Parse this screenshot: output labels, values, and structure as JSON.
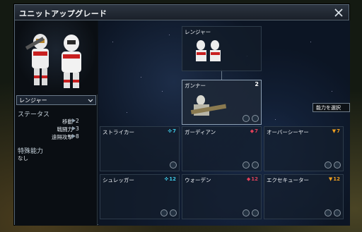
{
  "window": {
    "title": "ユニットアップグレード"
  },
  "left": {
    "selected_unit": "レンジャー",
    "status_heading": "ステータス",
    "stats": [
      {
        "label": "移動",
        "value": "2"
      },
      {
        "label": "戦闘力",
        "value": "3"
      },
      {
        "label": "遠隔攻撃",
        "value": "8"
      }
    ],
    "abilities_heading": "特殊能力",
    "abilities_value": "なし"
  },
  "tooltip": "能力を選択",
  "cards": [
    {
      "name": "レンジャー",
      "cost": "",
      "cost_color": "#ffffff"
    },
    {
      "name": "ガンナー",
      "cost": "2",
      "cost_color": "#ffffff"
    },
    {
      "name": "ストライカー",
      "cost": "7",
      "cost_color": "#3ec8e6"
    },
    {
      "name": "ガーディアン",
      "cost": "7",
      "cost_color": "#e0405a"
    },
    {
      "name": "オーバーシーヤー",
      "cost": "7",
      "cost_color": "#f0a020"
    },
    {
      "name": "シュレッガー",
      "cost": "12",
      "cost_color": "#3ec8e6"
    },
    {
      "name": "ウォーデン",
      "cost": "12",
      "cost_color": "#e0405a"
    },
    {
      "name": "エクセキューター",
      "cost": "12",
      "cost_color": "#f0a020"
    }
  ],
  "colors": {
    "affinity_blue": "#3ec8e6",
    "affinity_red": "#e0405a",
    "affinity_gold": "#f0a020"
  }
}
